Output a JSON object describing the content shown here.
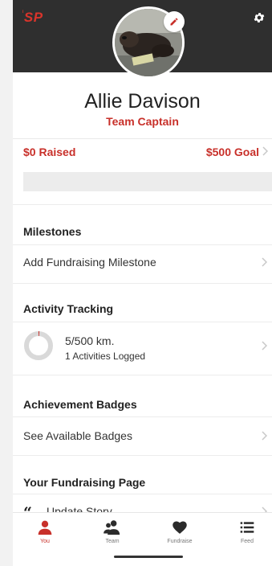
{
  "app": {
    "logo_text": "SP",
    "logo_prefix": "i",
    "accent_color": "#c8302a"
  },
  "profile": {
    "name": "Allie Davison",
    "role": "Team Captain",
    "raised": "$0 Raised",
    "goal": "$500 Goal",
    "progress_fraction": 0
  },
  "milestones": {
    "title": "Milestones",
    "action_label": "Add Fundraising Milestone"
  },
  "activity": {
    "title": "Activity Tracking",
    "distance": "5/500 km.",
    "activities": "1 Activities Logged",
    "progress_fraction": 0.01
  },
  "badges": {
    "title": "Achievement Badges",
    "action_label": "See Available Badges"
  },
  "fundraising_page": {
    "title": "Your Fundraising Page",
    "action_label": "Update Story"
  },
  "tabs": [
    {
      "label": "You",
      "icon": "person-icon",
      "active": true
    },
    {
      "label": "Team",
      "icon": "team-icon",
      "active": false
    },
    {
      "label": "Fundraise",
      "icon": "heart-icon",
      "active": false
    },
    {
      "label": "Feed",
      "icon": "list-icon",
      "active": false
    }
  ]
}
